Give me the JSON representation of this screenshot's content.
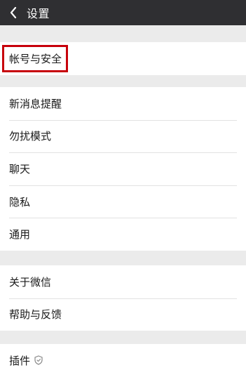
{
  "header": {
    "title": "设置",
    "back_icon": "back-arrow-icon"
  },
  "groups": [
    {
      "items": [
        {
          "label": "帐号与安全",
          "highlighted": true
        }
      ]
    },
    {
      "items": [
        {
          "label": "新消息提醒"
        },
        {
          "label": "勿扰模式"
        },
        {
          "label": "聊天"
        },
        {
          "label": "隐私"
        },
        {
          "label": "通用"
        }
      ]
    },
    {
      "items": [
        {
          "label": "关于微信"
        },
        {
          "label": "帮助与反馈"
        }
      ]
    },
    {
      "items": [
        {
          "label": "插件",
          "icon": "shield-icon"
        }
      ]
    }
  ],
  "colors": {
    "header_bg": "#2f2f32",
    "page_bg": "#ebebeb",
    "highlight": "#c7000b"
  }
}
